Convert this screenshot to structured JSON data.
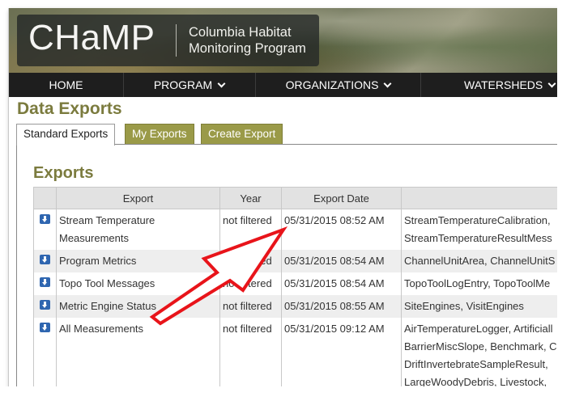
{
  "header": {
    "logo": "CHaMP",
    "subtitle_line1": "Columbia Habitat",
    "subtitle_line2": "Monitoring Program"
  },
  "nav": {
    "items": [
      {
        "label": "HOME"
      },
      {
        "label": "PROGRAM"
      },
      {
        "label": "ORGANIZATIONS"
      },
      {
        "label": "WATERSHEDS"
      }
    ]
  },
  "page": {
    "title": "Data Exports",
    "tabs": [
      {
        "label": "Standard Exports",
        "active": true
      },
      {
        "label": "My Exports",
        "active": false
      },
      {
        "label": "Create Export",
        "active": false
      }
    ]
  },
  "exports": {
    "title": "Exports",
    "columns": [
      "",
      "Export",
      "Year",
      "Export Date",
      ""
    ],
    "rows": [
      {
        "export_line1": "Stream Temperature",
        "export_line2": "Measurements",
        "year": "not filtered",
        "date": "05/31/2015 08:52 AM",
        "tables_line1": "StreamTemperatureCalibration,",
        "tables_line2": "StreamTemperatureResultMess"
      },
      {
        "export_line1": "Program Metrics",
        "year": "not filtered",
        "date": "05/31/2015 08:54 AM",
        "tables_line1": "ChannelUnitArea, ChannelUnitS"
      },
      {
        "export_line1": "Topo Tool Messages",
        "year": "not filtered",
        "date": "05/31/2015 08:54 AM",
        "tables_line1": "TopoToolLogEntry, TopoToolMe"
      },
      {
        "export_line1": "Metric Engine Status",
        "year": "not filtered",
        "date": "05/31/2015 08:55 AM",
        "tables_line1": "SiteEngines, VisitEngines"
      },
      {
        "export_line1": "All Measurements",
        "year": "not filtered",
        "date": "05/31/2015 09:12 AM",
        "tables_line1": "AirTemperatureLogger, Artificiall",
        "tables_line2": "BarrierMiscSlope, Benchmark, C",
        "tables_line3": "DriftInvertebrateSampleResult,",
        "tables_line4": "LargeWoodyDebris, Livestock,"
      }
    ]
  },
  "colors": {
    "nav_bg": "#1e1e1e",
    "title_olive": "#7b7b3e",
    "tab_inactive": "#9a9a48",
    "download_icon": "#2f66b0",
    "annotation_arrow": "#e8141a"
  },
  "icons": {
    "download": "download-arrow-icon",
    "chevron": "chevron-down-icon"
  }
}
